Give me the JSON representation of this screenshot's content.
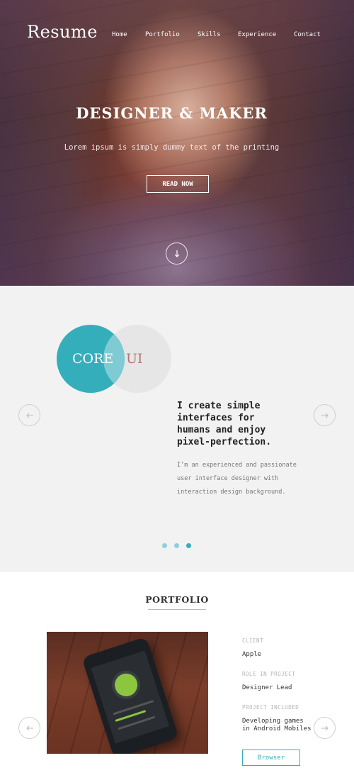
{
  "header": {
    "brand": "Resume",
    "nav": [
      "Home",
      "Portfolio",
      "Skills",
      "Experience",
      "Contact"
    ]
  },
  "hero": {
    "title": "DESIGNER & MAKER",
    "subtitle": "Lorem ipsum is simply dummy text of the printing",
    "cta_label": "READ NOW",
    "scroll_icon": "arrow-down-icon"
  },
  "about": {
    "venn_left": "CORE",
    "venn_right": "UI",
    "headline": "I create simple interfaces for humans and enjoy pixel-perfection.",
    "body": "I’m an experienced and passionate user interface designer with interaction design background.",
    "prev_icon": "arrow-left-icon",
    "next_icon": "arrow-right-icon",
    "slides_total": 3,
    "active_slide": 3
  },
  "portfolio": {
    "title": "PORTFOLIO",
    "client_label": "CLIENT",
    "client": "Apple",
    "role_label": "ROLE IN PROJECT",
    "role": "Designer Lead",
    "included_label": "PROJECT INCLUDED",
    "included": "Developing games in Android Mobiles",
    "button_label": "Browser"
  },
  "colors": {
    "accent": "#35aebb",
    "section_gray": "#f2f2f2",
    "venn_text_ui": "#b07777"
  }
}
